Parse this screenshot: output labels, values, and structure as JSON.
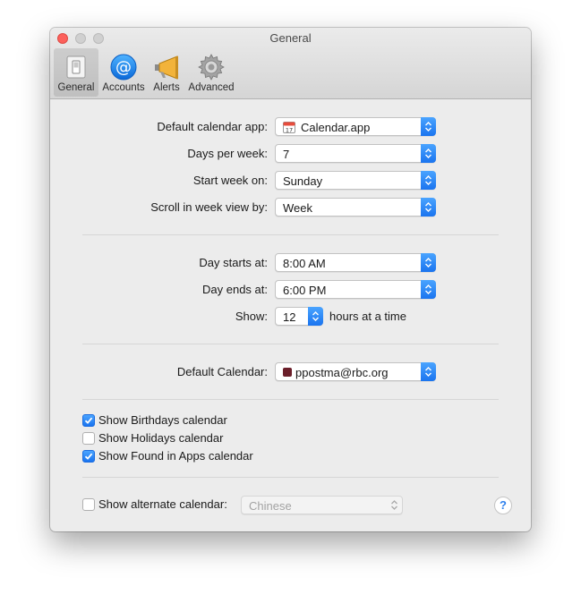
{
  "window": {
    "title": "General"
  },
  "toolbar": {
    "tabs": [
      {
        "label": "General",
        "icon": "switch-icon"
      },
      {
        "label": "Accounts",
        "icon": "at-sign-icon"
      },
      {
        "label": "Alerts",
        "icon": "megaphone-icon"
      },
      {
        "label": "Advanced",
        "icon": "gear-icon"
      }
    ],
    "selected": "General"
  },
  "general": {
    "default_app_label": "Default calendar app:",
    "default_app_value": "Calendar.app",
    "days_per_week_label": "Days per week:",
    "days_per_week_value": "7",
    "start_week_label": "Start week on:",
    "start_week_value": "Sunday",
    "scroll_label": "Scroll in week view by:",
    "scroll_value": "Week"
  },
  "day": {
    "starts_label": "Day starts at:",
    "starts_value": "8:00 AM",
    "ends_label": "Day ends at:",
    "ends_value": "6:00 PM",
    "show_label": "Show:",
    "show_value": "12",
    "show_suffix": "hours at a time"
  },
  "calendar": {
    "default_label": "Default Calendar:",
    "default_value": "ppostma@rbc.org",
    "swatch_color": "#6b1f2a"
  },
  "checkboxes": [
    {
      "label": "Show Birthdays calendar",
      "checked": true
    },
    {
      "label": "Show Holidays calendar",
      "checked": false
    },
    {
      "label": "Show Found in Apps calendar",
      "checked": true
    }
  ],
  "alternate": {
    "label": "Show alternate calendar:",
    "checked": false,
    "value": "Chinese"
  },
  "help": {
    "glyph": "?"
  },
  "colors": {
    "accent": "#1a74ef",
    "close": "#fc605b"
  }
}
